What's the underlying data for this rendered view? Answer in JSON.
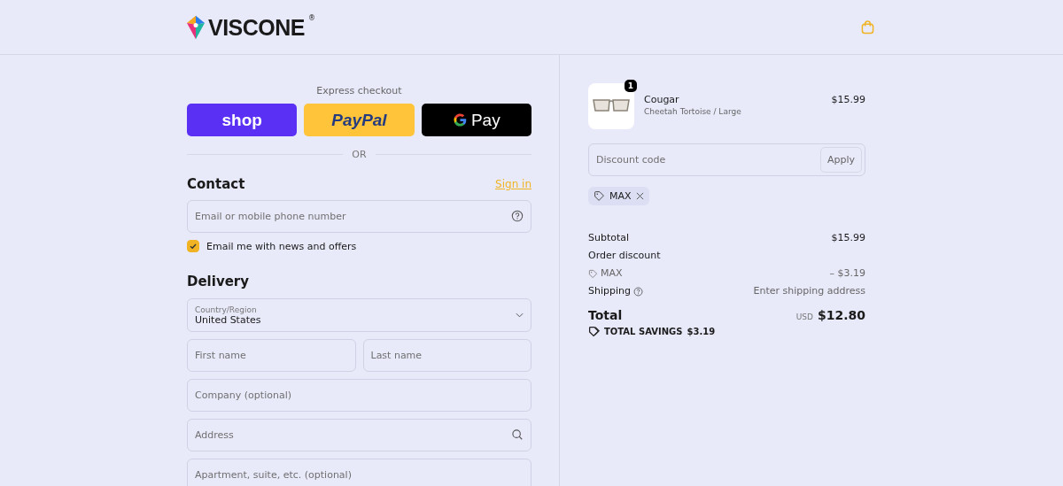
{
  "header": {
    "logo": {
      "text": "VISCONE",
      "mark": "®"
    }
  },
  "express_checkout": {
    "title": "Express checkout",
    "buttons": [
      {
        "kind": "shop",
        "label": "shop"
      },
      {
        "kind": "paypal",
        "label": "PayPal"
      },
      {
        "kind": "gpay",
        "label": "Pay"
      }
    ],
    "divider": "OR"
  },
  "contact": {
    "title": "Contact",
    "link": "Sign in",
    "email": {
      "placeholder": "Email or mobile phone number"
    },
    "newsletter": {
      "label": "Email me with news and offers",
      "checked": true
    }
  },
  "delivery": {
    "title": "Delivery",
    "fields": [
      {
        "kind": "select",
        "label": "Country/Region",
        "value": "United States"
      },
      {
        "kind": "pair",
        "items": [
          {
            "placeholder": "First name"
          },
          {
            "placeholder": "Last name"
          }
        ]
      },
      {
        "kind": "text",
        "placeholder": "Company (optional)"
      },
      {
        "kind": "search",
        "placeholder": "Address"
      },
      {
        "kind": "text",
        "placeholder": "Apartment, suite, etc. (optional)"
      }
    ]
  },
  "summary": {
    "product": {
      "name": "Cougar",
      "variant": "Cheetah Tortoise / Large",
      "price": "$15.99",
      "quantity": "1"
    },
    "discount": {
      "placeholder": "Discount code",
      "button": "Apply",
      "applied_code": "MAX"
    },
    "lines": [
      {
        "kind": "plain",
        "label": "Subtotal",
        "value": "$15.99"
      },
      {
        "kind": "heading",
        "label": "Order discount"
      },
      {
        "kind": "code",
        "label": "MAX",
        "value": "– $3.19"
      },
      {
        "kind": "help",
        "label": "Shipping",
        "value": "Enter shipping address"
      }
    ],
    "total": {
      "label": "Total",
      "currency": "USD",
      "value": "$12.80"
    },
    "savings": {
      "label": "TOTAL SAVINGS",
      "value": "$3.19"
    }
  }
}
